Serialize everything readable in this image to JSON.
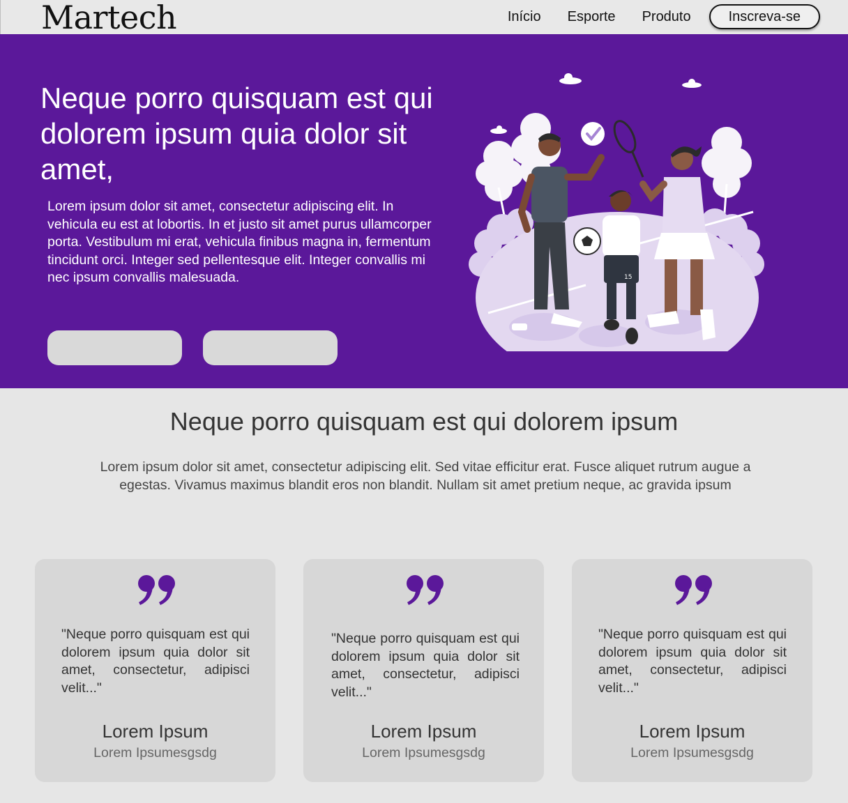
{
  "header": {
    "logo": "Martech",
    "nav": [
      "Início",
      "Esporte",
      "Produto"
    ],
    "cta": "Inscreva-se"
  },
  "hero": {
    "title": "Neque porro quisquam est qui dolorem ipsum quia dolor sit amet,",
    "text": "Lorem ipsum dolor sit amet, consectetur adipiscing elit. In vehicula eu est at lobortis. In et justo sit amet purus ullamcorper porta. Vestibulum mi erat, vehicula finibus magna in, fermentum tincidunt orci. Integer sed pellentesque elit. Integer convallis mi nec ipsum convallis malesuada.",
    "buttons": [
      "",
      ""
    ]
  },
  "section": {
    "title": "Neque porro quisquam est qui dolorem ipsum",
    "text": "Lorem ipsum dolor sit amet, consectetur adipiscing elit. Sed vitae efficitur erat. Fusce aliquet rutrum augue a egestas. Vivamus maximus blandit eros non blandit. Nullam sit amet pretium neque, ac gravida ipsum"
  },
  "testimonials": [
    {
      "quote": "\"Neque porro quisquam est qui dolorem ipsum quia dolor sit amet, consectetur, adipisci velit...\"",
      "name": "Lorem Ipsum",
      "role": "Lorem Ipsumesgsdg"
    },
    {
      "quote": "\"Neque porro quisquam est qui dolorem ipsum quia dolor sit amet, consectetur, adipisci velit...\"",
      "name": "Lorem Ipsum",
      "role": "Lorem Ipsumesgsdg"
    },
    {
      "quote": "\"Neque porro quisquam est qui dolorem ipsum quia dolor sit amet, consectetur, adipisci velit...\"",
      "name": "Lorem Ipsum",
      "role": "Lorem Ipsumesgsdg"
    }
  ],
  "colors": {
    "brand_purple": "#5b189a",
    "page_bg": "#e6e6e6",
    "card_bg": "#d7d7d7"
  },
  "icons": {
    "quote": "quote-icon",
    "illustration": "sports-family-illustration"
  }
}
